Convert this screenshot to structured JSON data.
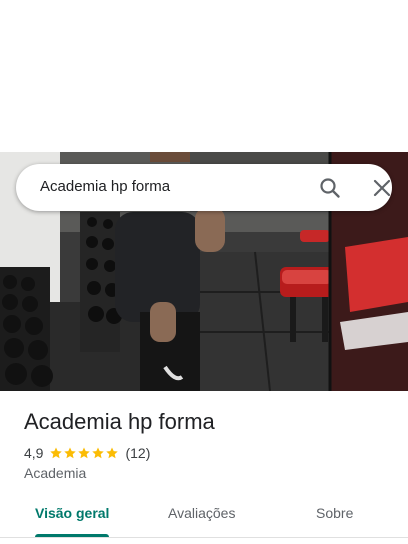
{
  "search": {
    "query": "Academia hp forma"
  },
  "icons": {
    "search": "search-icon",
    "close": "close-icon",
    "star": "star-icon"
  },
  "place": {
    "title": "Academia hp forma",
    "rating": "4,9",
    "stars": 5,
    "review_count": "(12)",
    "category": "Academia"
  },
  "tabs": [
    {
      "label": "Visão geral",
      "active": true
    },
    {
      "label": "Avaliações",
      "active": false
    },
    {
      "label": "Sobre",
      "active": false
    }
  ],
  "colors": {
    "accent": "#00796b",
    "star": "#fbbc04",
    "wall_banner": "#c62828"
  }
}
